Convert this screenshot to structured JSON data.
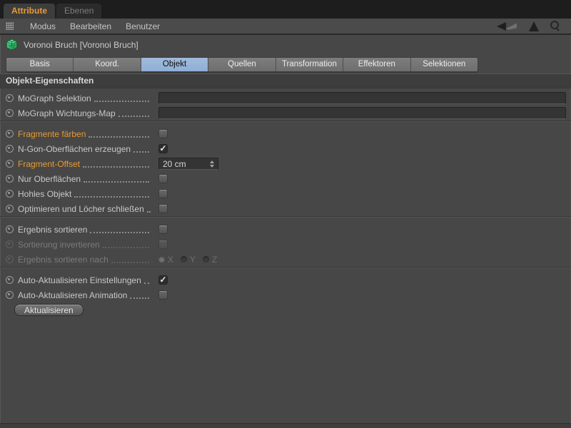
{
  "colors": {
    "modified_text": "#E79A35",
    "active_tab_text": "#E79B36",
    "active_segment_bg": "#92AFD7",
    "object_icon_green": "#3ECB7E",
    "panel_background": "#474747"
  },
  "icons": {
    "check": "✓",
    "names": [
      "drag-grid-icon",
      "voronoi-fracture-icon",
      "back-arrow-icon",
      "forward-arrow-disabled-icon",
      "up-arrow-icon",
      "search-icon",
      "spinner-up-icon",
      "spinner-down-icon",
      "keyframe-dot"
    ]
  },
  "panel_tabs": [
    {
      "label": "Attribute",
      "active": true
    },
    {
      "label": "Ebenen",
      "active": false
    }
  ],
  "menubar": {
    "items": [
      "Modus",
      "Bearbeiten",
      "Benutzer"
    ]
  },
  "object_header": {
    "title": "Voronoi Bruch [Voronoi Bruch]"
  },
  "segments": [
    {
      "label": "Basis",
      "active": false
    },
    {
      "label": "Koord.",
      "active": false
    },
    {
      "label": "Objekt",
      "active": true
    },
    {
      "label": "Quellen",
      "active": false
    },
    {
      "label": "Transformation",
      "active": false
    },
    {
      "label": "Effektoren",
      "active": false
    },
    {
      "label": "Selektionen",
      "active": false
    }
  ],
  "section_title": "Objekt-Eigenschaften",
  "rows": {
    "mograph_selektion": {
      "label": "MoGraph Selektion",
      "value": ""
    },
    "mograph_wichtungs_map": {
      "label": "MoGraph Wichtungs-Map",
      "value": ""
    },
    "fragmente_faerben": {
      "label": "Fragmente färben",
      "checked": false,
      "modified": true
    },
    "ngon_oberflaechen": {
      "label": "N-Gon-Oberflächen erzeugen",
      "checked": true,
      "modified": false
    },
    "fragment_offset": {
      "label": "Fragment-Offset",
      "value": "20 cm",
      "modified": true
    },
    "nur_oberflaechen": {
      "label": "Nur Oberflächen",
      "checked": false
    },
    "hohles_objekt": {
      "label": "Hohles Objekt",
      "checked": false
    },
    "optimieren_loecher": {
      "label": "Optimieren und Löcher schließen",
      "checked": false
    },
    "ergebnis_sortieren": {
      "label": "Ergebnis sortieren",
      "checked": false
    },
    "sortierung_invertieren": {
      "label": "Sortierung invertieren",
      "checked": false,
      "disabled": true
    },
    "ergebnis_sortieren_nach": {
      "label": "Ergebnis sortieren nach",
      "disabled": true,
      "options": [
        {
          "label": "X",
          "selected": true
        },
        {
          "label": "Y",
          "selected": false
        },
        {
          "label": "Z",
          "selected": false
        }
      ]
    },
    "auto_aktualisieren_einstellungen": {
      "label": "Auto-Aktualisieren Einstellungen",
      "checked": true
    },
    "auto_aktualisieren_animation": {
      "label": "Auto-Aktualisieren Animation",
      "checked": false
    },
    "aktualisieren": {
      "label": "Aktualisieren"
    }
  }
}
